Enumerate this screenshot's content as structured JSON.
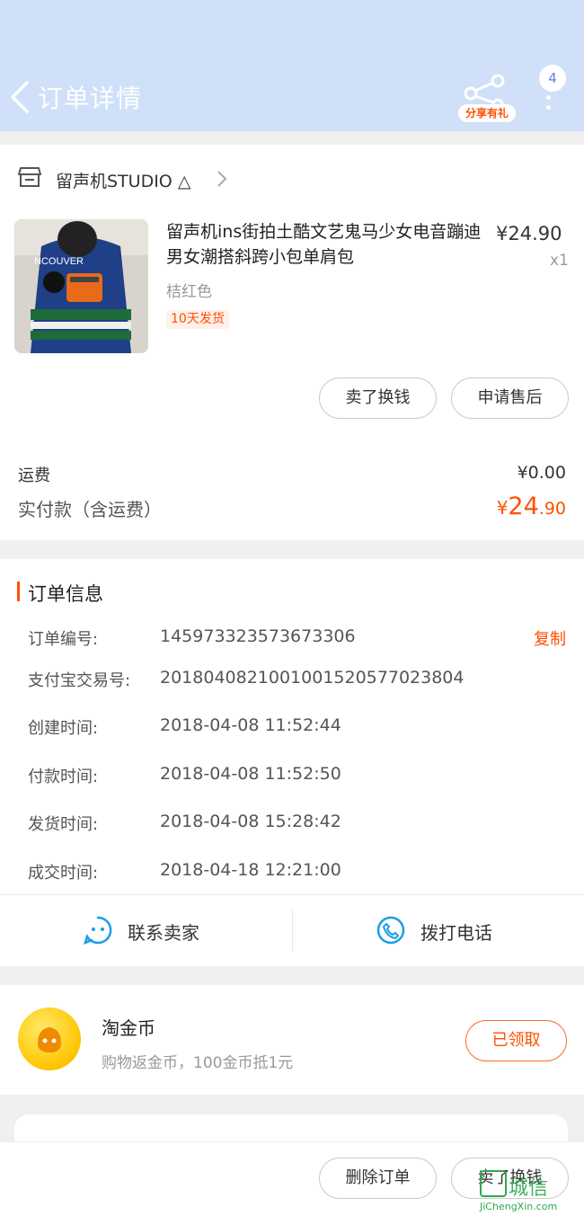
{
  "header": {
    "title": "订单详情",
    "share_label": "分享有礼",
    "badge_count": "4"
  },
  "shop": {
    "name": "留声机STUDIO",
    "name_symbol": "△"
  },
  "product": {
    "title": "留声机ins街拍土酷文艺鬼马少女电音蹦迪男女潮搭斜跨小包单肩包",
    "price": "¥24.90",
    "qty": "x1",
    "color": "桔红色",
    "ship_tag": "10天发货",
    "thumb_text": "NCOUVER"
  },
  "product_actions": {
    "sell": "卖了换钱",
    "after_sale": "申请售后"
  },
  "summary": {
    "fee_label": "运费",
    "fee_value": "¥0.00",
    "paid_label": "实付款（含运费）",
    "paid_currency": "¥",
    "paid_int": "24",
    "paid_dec": ".90"
  },
  "order_info": {
    "title": "订单信息",
    "copy_label": "复制",
    "rows": [
      {
        "key": "订单编号:",
        "value": "145973323573673306"
      },
      {
        "key": "支付宝交易号:",
        "value": "2018040821001001520577023804"
      },
      {
        "key": "创建时间:",
        "value": "2018-04-08 11:52:44"
      },
      {
        "key": "付款时间:",
        "value": "2018-04-08 11:52:50"
      },
      {
        "key": "发货时间:",
        "value": "2018-04-08 15:28:42"
      },
      {
        "key": "成交时间:",
        "value": "2018-04-18 12:21:00"
      }
    ]
  },
  "contact": {
    "seller": "联系卖家",
    "phone": "拨打电话"
  },
  "coin": {
    "title": "淘金币",
    "subtitle": "购物返金币，100金币抵1元",
    "button": "已领取"
  },
  "footer": {
    "delete": "删除订单",
    "sell": "卖了换钱"
  },
  "watermark": {
    "text": "城信",
    "url": "JiChengXin.com"
  },
  "colors": {
    "accent": "#ff5000",
    "header_bg": "#cfe0f8",
    "link_blue": "#1a9de8"
  }
}
